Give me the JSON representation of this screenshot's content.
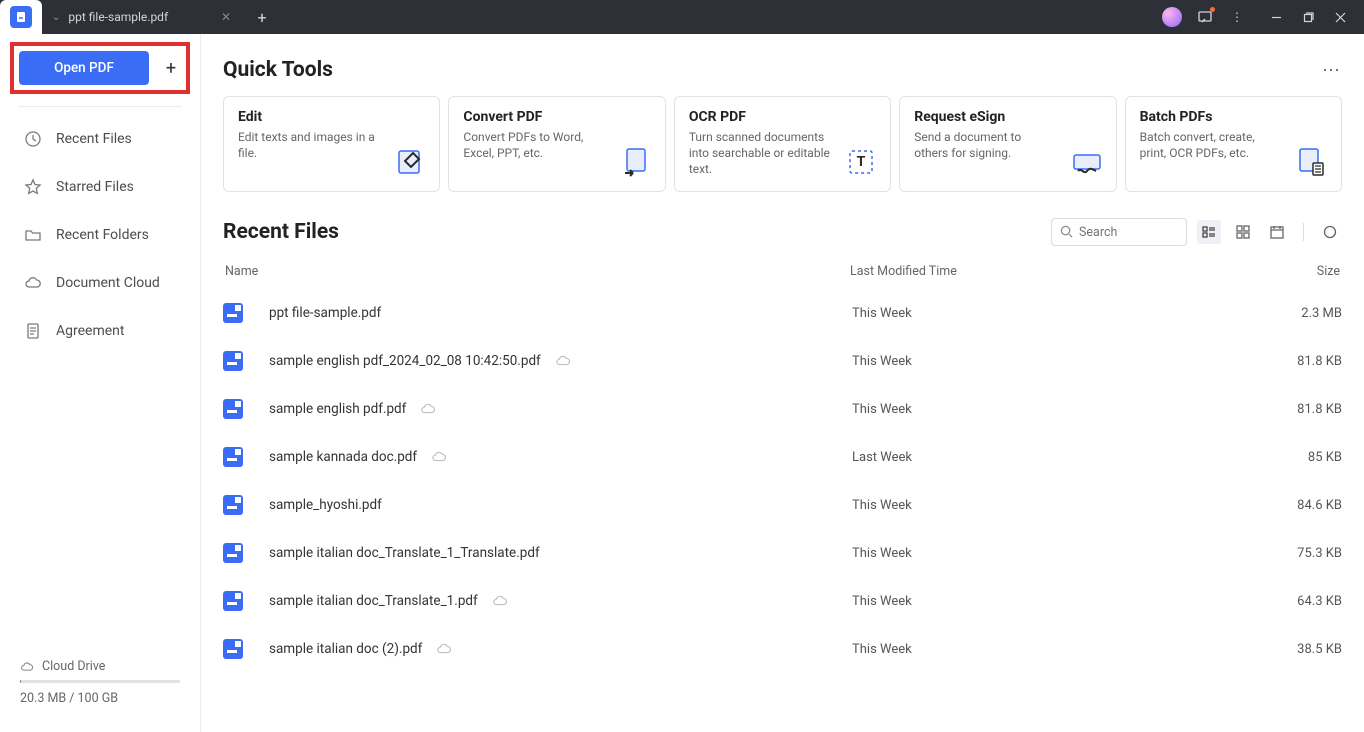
{
  "titlebar": {
    "tab_name": "ppt file-sample.pdf"
  },
  "sidebar": {
    "open_pdf_label": "Open PDF",
    "items": [
      {
        "label": "Recent Files"
      },
      {
        "label": "Starred Files"
      },
      {
        "label": "Recent Folders"
      },
      {
        "label": "Document Cloud"
      },
      {
        "label": "Agreement"
      }
    ],
    "cloud_label": "Cloud Drive",
    "cloud_usage": "20.3 MB / 100 GB"
  },
  "main": {
    "quick_tools_title": "Quick Tools",
    "tools": [
      {
        "title": "Edit",
        "desc": "Edit texts and images in a file."
      },
      {
        "title": "Convert PDF",
        "desc": "Convert PDFs to Word, Excel, PPT, etc."
      },
      {
        "title": "OCR PDF",
        "desc": "Turn scanned documents into searchable or editable text."
      },
      {
        "title": "Request eSign",
        "desc": "Send a document to others for signing."
      },
      {
        "title": "Batch PDFs",
        "desc": "Batch convert, create, print, OCR PDFs, etc."
      }
    ],
    "recent_files_title": "Recent Files",
    "search_placeholder": "Search",
    "columns": {
      "name": "Name",
      "modified": "Last Modified Time",
      "size": "Size"
    },
    "files": [
      {
        "name": "ppt file-sample.pdf",
        "modified": "This Week",
        "size": "2.3 MB",
        "cloud": false
      },
      {
        "name": "sample english pdf_2024_02_08 10:42:50.pdf",
        "modified": "This Week",
        "size": "81.8 KB",
        "cloud": true
      },
      {
        "name": "sample english pdf.pdf",
        "modified": "This Week",
        "size": "81.8 KB",
        "cloud": true
      },
      {
        "name": "sample kannada doc.pdf",
        "modified": "Last Week",
        "size": "85 KB",
        "cloud": true
      },
      {
        "name": "sample_hyoshi.pdf",
        "modified": "This Week",
        "size": "84.6 KB",
        "cloud": false
      },
      {
        "name": "sample italian doc_Translate_1_Translate.pdf",
        "modified": "This Week",
        "size": "75.3 KB",
        "cloud": false
      },
      {
        "name": "sample italian doc_Translate_1.pdf",
        "modified": "This Week",
        "size": "64.3 KB",
        "cloud": true
      },
      {
        "name": "sample italian doc (2).pdf",
        "modified": "This Week",
        "size": "38.5 KB",
        "cloud": true
      }
    ]
  }
}
